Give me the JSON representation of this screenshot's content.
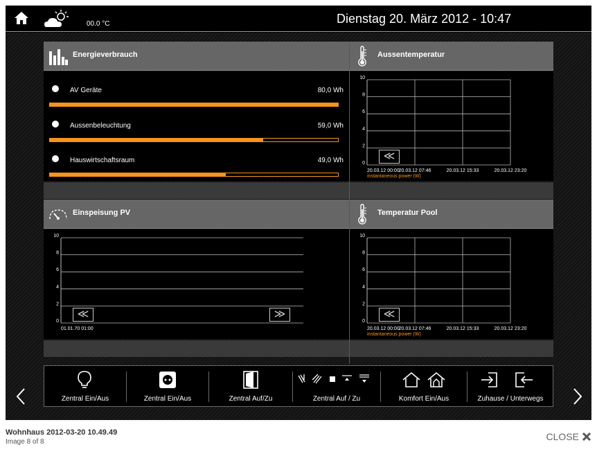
{
  "header": {
    "temperature": "00.0 °C",
    "datetime": "Dienstag 20. März 2012 - 10:47"
  },
  "energy": {
    "title": "Energieverbrauch",
    "items": [
      {
        "label": "AV Geräte",
        "value": "80,0 Wh",
        "fraction": 1.0
      },
      {
        "label": "Aussenbeleuchtung",
        "value": "59,0 Wh",
        "fraction": 0.74
      },
      {
        "label": "Hauswirtschaftsraum",
        "value": "49,0 Wh",
        "fraction": 0.61
      }
    ]
  },
  "outside_temp": {
    "title": "Aussentemperatur",
    "back_button": "≪",
    "legend": "instantaneous power (W)"
  },
  "pv": {
    "title": "Einspeisung PV",
    "back_button": "≪",
    "forward_button": "≫"
  },
  "pool_temp": {
    "title": "Temperatur Pool",
    "back_button": "≪",
    "legend": "instantaneous power (W)"
  },
  "chart_data": [
    {
      "type": "line",
      "title": "Aussentemperatur",
      "x_ticks": [
        "20.03.12 00:00",
        "20.03.12 07:46",
        "20.03.12 15:33",
        "20.03.12 23:20"
      ],
      "y_ticks": [
        "0",
        "2",
        "4",
        "6",
        "8",
        "10"
      ],
      "ylim": [
        0,
        10
      ],
      "grid": true,
      "series": [
        {
          "name": "instantaneous power (W)",
          "values": []
        }
      ]
    },
    {
      "type": "line",
      "title": "Einspeisung PV",
      "x_ticks": [
        "01.01.70 01:00"
      ],
      "y_ticks": [
        "0",
        "2",
        "4",
        "6",
        "8",
        "10"
      ],
      "ylim": [
        0,
        10
      ],
      "grid": true,
      "series": []
    },
    {
      "type": "line",
      "title": "Temperatur Pool",
      "x_ticks": [
        "20.03.12 00:00",
        "20.03.12 07:46",
        "20.03.12 15:33",
        "20.03.12 23:20"
      ],
      "y_ticks": [
        "0",
        "2",
        "4",
        "6",
        "8",
        "10"
      ],
      "ylim": [
        0,
        10
      ],
      "grid": true,
      "series": [
        {
          "name": "instantaneous power (W)",
          "values": []
        }
      ]
    }
  ],
  "toolbar": {
    "items": [
      {
        "label": "Zentral Ein/Aus",
        "icon": "lightbulb-icon"
      },
      {
        "label": "Zentral Ein/Aus",
        "icon": "power-socket-icon"
      },
      {
        "label": "Zentral Auf/Zu",
        "icon": "door-icon"
      },
      {
        "label": "Zentral Auf / Zu",
        "icon": "blinds-icon"
      },
      {
        "label": "Komfort Ein/Aus",
        "icon": "house-icon"
      },
      {
        "label": "Zuhause / Unterwegs",
        "icon": "login-logout-icon"
      }
    ]
  },
  "caption": {
    "title": "Wohnhaus 2012-03-20 10.49.49",
    "subtitle": "Image 8 of 8",
    "close_label": "CLOSE"
  },
  "colors": {
    "accent": "#f7941d",
    "header_bg": "#666666",
    "frame_bg": "#000000"
  }
}
